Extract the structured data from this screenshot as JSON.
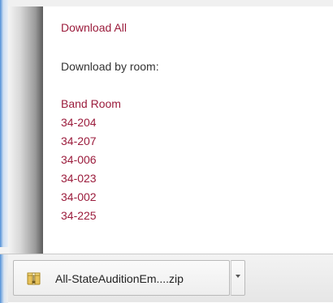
{
  "page": {
    "download_all_label": "Download All",
    "download_by_room_label": "Download by room:",
    "rooms": [
      "Band Room",
      "34-204",
      "34-207",
      "34-006",
      "34-023",
      "34-002",
      "34-225"
    ]
  },
  "download_bar": {
    "file_name": "All-StateAuditionEm....zip",
    "file_icon": "zip-archive-icon",
    "menu_icon": "chevron-down-icon"
  },
  "colors": {
    "link": "#9b1c3c",
    "text": "#333333",
    "accent_blue": "#4e8fd6"
  }
}
